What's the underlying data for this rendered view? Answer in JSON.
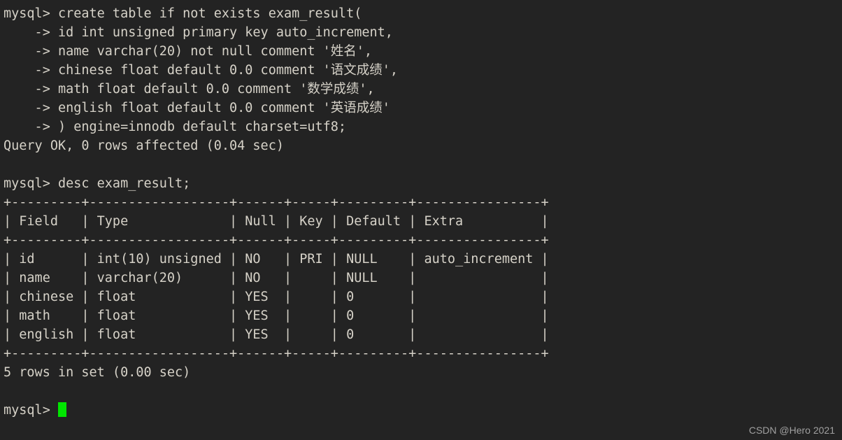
{
  "terminal": {
    "background_color": "#232323",
    "foreground_color": "#d6d2c8",
    "cursor_color": "#00e500",
    "lines": [
      "mysql> create table if not exists exam_result(",
      "    -> id int unsigned primary key auto_increment,",
      "    -> name varchar(20) not null comment '姓名',",
      "    -> chinese float default 0.0 comment '语文成绩',",
      "    -> math float default 0.0 comment '数学成绩',",
      "    -> english float default 0.0 comment '英语成绩'",
      "    -> ) engine=innodb default charset=utf8;",
      "Query OK, 0 rows affected (0.04 sec)",
      "",
      "mysql> desc exam_result;",
      "+---------+------------------+------+-----+---------+----------------+",
      "| Field   | Type             | Null | Key | Default | Extra          |",
      "+---------+------------------+------+-----+---------+----------------+",
      "| id      | int(10) unsigned | NO   | PRI | NULL    | auto_increment |",
      "| name    | varchar(20)      | NO   |     | NULL    |                |",
      "| chinese | float            | YES  |     | 0       |                |",
      "| math    | float            | YES  |     | 0       |                |",
      "| english | float            | YES  |     | 0       |                |",
      "+---------+------------------+------+-----+---------+----------------+",
      "5 rows in set (0.00 sec)",
      "",
      "mysql> "
    ],
    "prompt": "mysql> ",
    "statements": {
      "create_table": {
        "table_name": "exam_result",
        "engine": "innodb",
        "charset": "utf8",
        "columns": [
          "id int unsigned primary key auto_increment",
          "name varchar(20) not null comment '姓名'",
          "chinese float default 0.0 comment '语文成绩'",
          "math float default 0.0 comment '数学成绩'",
          "english float default 0.0 comment '英语成绩'"
        ]
      },
      "create_result": "Query OK, 0 rows affected (0.04 sec)",
      "desc_command": "desc exam_result;",
      "desc_result_summary": "5 rows in set (0.00 sec)"
    },
    "desc_table": {
      "headers": [
        "Field",
        "Type",
        "Null",
        "Key",
        "Default",
        "Extra"
      ],
      "rows": [
        [
          "id",
          "int(10) unsigned",
          "NO",
          "PRI",
          "NULL",
          "auto_increment"
        ],
        [
          "name",
          "varchar(20)",
          "NO",
          "",
          "NULL",
          ""
        ],
        [
          "chinese",
          "float",
          "YES",
          "",
          "0",
          ""
        ],
        [
          "math",
          "float",
          "YES",
          "",
          "0",
          ""
        ],
        [
          "english",
          "float",
          "YES",
          "",
          "0",
          ""
        ]
      ]
    }
  },
  "watermark": {
    "text": "CSDN @Hero 2021"
  }
}
